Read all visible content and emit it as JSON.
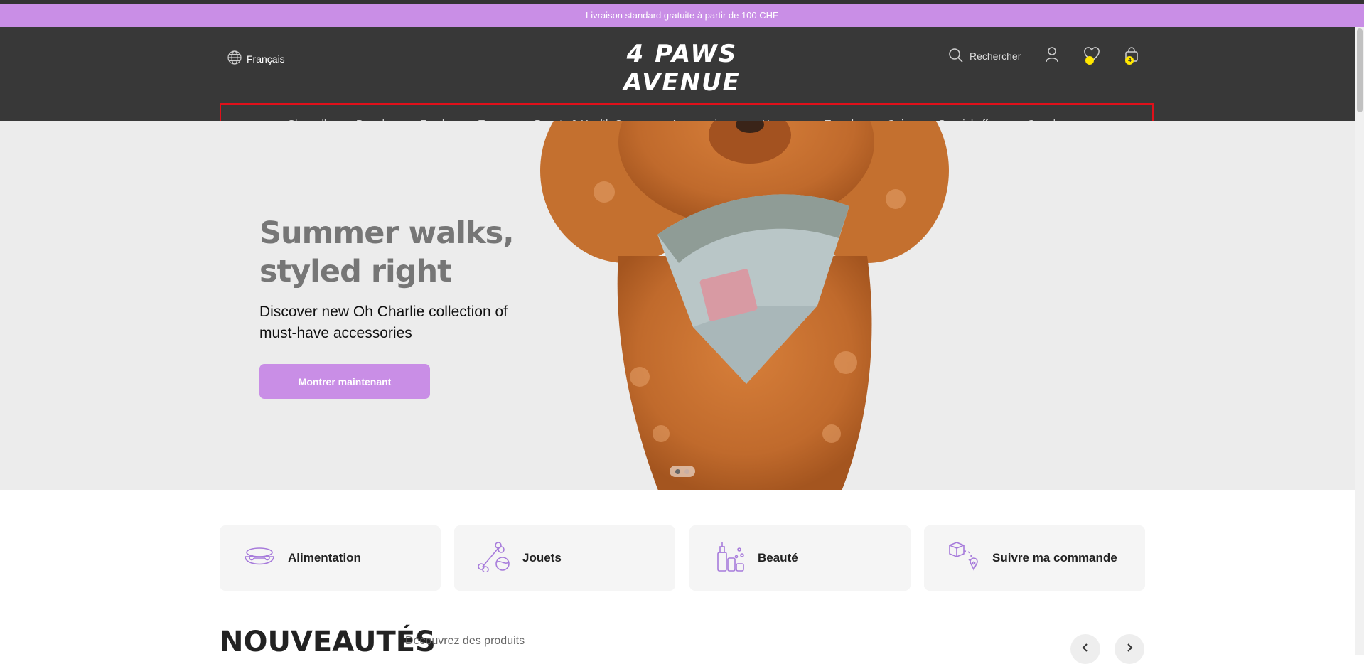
{
  "announcement": {
    "text": "Livraison standard gratuite à partir de 100 CHF"
  },
  "header": {
    "language": "Français",
    "logo": "4 PAWS AVENUE",
    "search_label": "Rechercher",
    "wishlist_badge": "",
    "cart_badge": "4"
  },
  "nav": {
    "items": [
      {
        "label": "Shop all"
      },
      {
        "label": "Brands"
      },
      {
        "label": "Food"
      },
      {
        "label": "Toys"
      },
      {
        "label": "Beauty & Health Care"
      },
      {
        "label": "Accessories"
      },
      {
        "label": "Home"
      },
      {
        "label": "Travel"
      },
      {
        "label": "Quiz"
      },
      {
        "label": "Special offer"
      },
      {
        "label": "Our shops"
      }
    ]
  },
  "hero": {
    "title_line1": "Summer walks,",
    "title_line2": "styled right",
    "subtitle": "Discover new Oh Charlie collection of must-have accessories",
    "cta": "Montrer maintenant"
  },
  "categories": {
    "cards": [
      {
        "label": "Alimentation",
        "icon": "bowl-icon"
      },
      {
        "label": "Jouets",
        "icon": "bone-ball-icon"
      },
      {
        "label": "Beauté",
        "icon": "bottles-icon"
      },
      {
        "label": "Suivre ma commande",
        "icon": "parcel-tracking-icon"
      }
    ]
  },
  "novelties": {
    "title": "NOUVEAUTÉS",
    "subtitle": "Découvrez des produits"
  },
  "colors": {
    "accent": "#c98ee6",
    "header_bg": "#383838",
    "badge": "#ffe600",
    "nav_highlight": "#e0101a"
  }
}
